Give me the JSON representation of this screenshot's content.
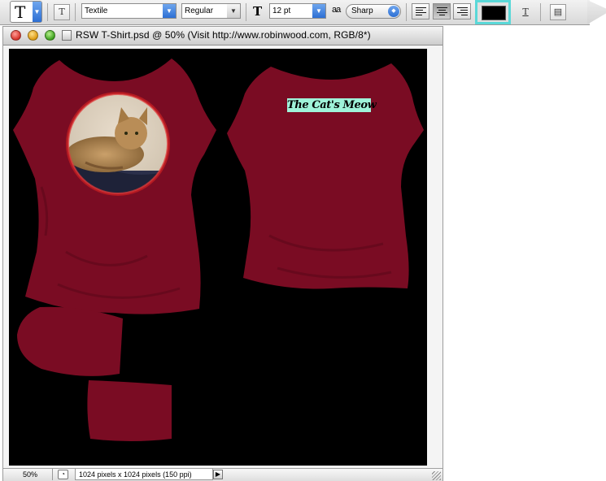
{
  "options_bar": {
    "tool_glyph": "T",
    "orientation_glyph": "T",
    "font_family": "Textile",
    "font_style": "Regular",
    "size_glyph": "T",
    "font_size": "12 pt",
    "aa_glyph": "a a",
    "antialias": "Sharp",
    "text_color": "#000000",
    "warp_glyph": "T"
  },
  "document": {
    "title": "RSW T-Shirt.psd @ 50% (Visit http://www.robinwood.com, RGB/8*)",
    "canvas_text": "The Cat's Meow",
    "shirt_color": "#7a0c23",
    "text_highlight": "#9ff3d9"
  },
  "status": {
    "zoom": "50%",
    "info": "1024 pixels x 1024 pixels (150 ppi)"
  }
}
